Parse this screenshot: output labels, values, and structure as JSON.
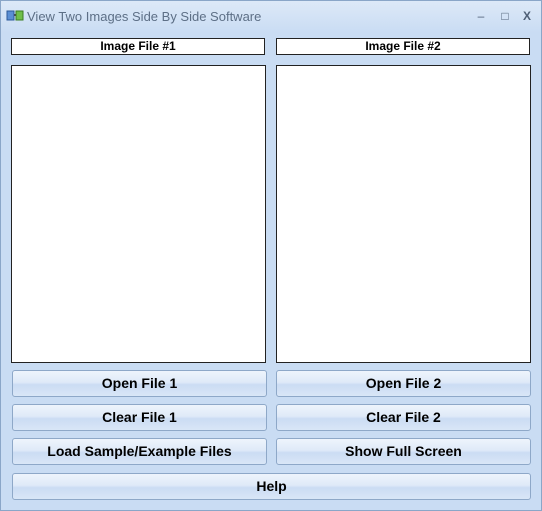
{
  "window": {
    "title": "View Two Images Side By Side Software",
    "controls": {
      "minimize": "–",
      "maximize": "□",
      "close": "X"
    }
  },
  "panels": {
    "left_label": "Image File #1",
    "right_label": "Image File #2"
  },
  "buttons": {
    "open_file_1": "Open File 1",
    "open_file_2": "Open File 2",
    "clear_file_1": "Clear File 1",
    "clear_file_2": "Clear File 2",
    "load_sample": "Load Sample/Example Files",
    "show_full_screen": "Show Full Screen",
    "help": "Help"
  },
  "colors": {
    "window_bg": "#c9dcf3",
    "title_text": "#5d6f86",
    "button_border": "#8ea8c8"
  },
  "icons": {
    "app": "app-icon"
  }
}
